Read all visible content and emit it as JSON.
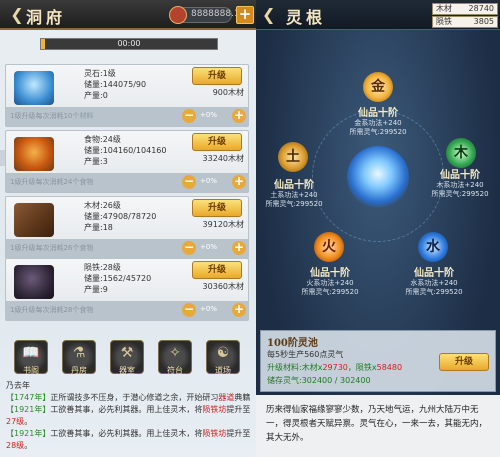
{
  "left": {
    "title": "洞府",
    "resource_value": "8888888.10",
    "timer": "00:00",
    "timer_progress": 0.02,
    "cards": [
      {
        "name": "灵石:1级",
        "storage": "储量:144075/90",
        "output": "产量:0",
        "cost": "900木材",
        "upgrade": "升级",
        "strip": "1级升级每次消耗10个材料",
        "pct": "+0%",
        "icon": "crystal-icon"
      },
      {
        "name": "食物:24级",
        "storage": "储量:104160/104160",
        "output": "产量:3",
        "cost": "33240木材",
        "upgrade": "升级",
        "strip": "1级升级每次消耗24个食物",
        "pct": "+0%",
        "icon": "food-icon"
      },
      {
        "name": "木材:26级",
        "storage": "储量:47908/78720",
        "output": "产量:18",
        "cost": "39120木材",
        "upgrade": "升级",
        "strip": "1级升级每次消耗26个食物",
        "pct": "+0%",
        "icon": "wood-icon"
      },
      {
        "name": "陨铁:28级",
        "storage": "储量:1562/45720",
        "output": "产量:9",
        "cost": "30360木材",
        "upgrade": "升级",
        "strip": "1级升级每次消耗28个食物",
        "pct": "+0%",
        "icon": "ore-icon"
      }
    ],
    "nav": [
      "书阁",
      "丹房",
      "器室",
      "符台",
      "道场"
    ],
    "log": [
      {
        "year": "",
        "text": "乃去年"
      },
      {
        "year": "【1747年】",
        "pre": "正所谓技多不压身，于潜心修道之余，开始研习",
        "hl": "器道",
        "post": "典籍。"
      },
      {
        "year": "【1921年】",
        "pre": "工欲善其事，必先利其器。用上佳灵木，将",
        "hl": "陨铁坊",
        "post": "提升至"
      },
      {
        "year": "",
        "pre": "",
        "hl": "27级",
        "post": "。"
      },
      {
        "year": "【1921年】",
        "pre": "工欲善其事，必先利其器。用上佳灵木，将",
        "hl": "陨铁坊",
        "post": "提升至"
      },
      {
        "year": "",
        "pre": "",
        "hl": "28级",
        "post": "。"
      }
    ]
  },
  "right": {
    "title": "灵根",
    "stats": [
      {
        "label": "木材",
        "value": "28740"
      },
      {
        "label": "陨铁",
        "value": "3805"
      }
    ],
    "elements": [
      {
        "glyph": "金",
        "title": "仙品十阶",
        "line1": "金系功法+240",
        "line2": "所需灵气:299520"
      },
      {
        "glyph": "木",
        "title": "仙品十阶",
        "line1": "木系功法+240",
        "line2": "所需灵气:299520"
      },
      {
        "glyph": "土",
        "title": "仙品十阶",
        "line1": "土系功法+240",
        "line2": "所需灵气:299520"
      },
      {
        "glyph": "火",
        "title": "仙品十阶",
        "line1": "火系功法+240",
        "line2": "所需灵气:299520"
      },
      {
        "glyph": "水",
        "title": "仙品十阶",
        "line1": "水系功法+240",
        "line2": "所需灵气:299520"
      }
    ],
    "pool": {
      "title": "100阶灵池",
      "line1": "每5秒生产560点灵气",
      "line2_pre": "升级材料:木材x",
      "line2_wood": "29730",
      "line2_mid": "，陨铁x",
      "line2_iron": "58480",
      "line3": "储存灵气:302400 / 302400",
      "upgrade": "升级"
    },
    "lore": "历来得仙家福缘寥寥少数，乃天地气运，九州大陆万中无一，得灵根者天赋异禀。灵气在心，一来一去，其能无内，其大无外。"
  },
  "colors": {
    "gold": "#e9a92b",
    "metal": "#f2b23a",
    "wood": "#34a853",
    "earth": "#d99a2b",
    "fire": "#f08a1c",
    "water": "#2f7de0"
  }
}
